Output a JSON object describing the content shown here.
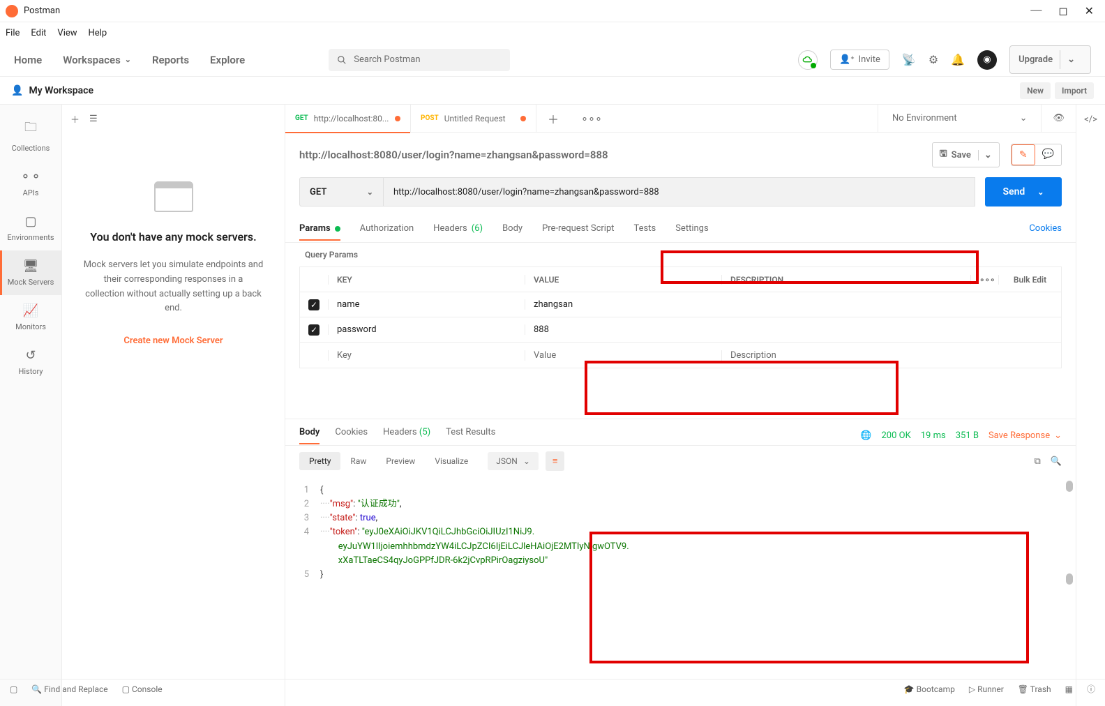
{
  "window": {
    "title": "Postman"
  },
  "menu": {
    "file": "File",
    "edit": "Edit",
    "view": "View",
    "help": "Help"
  },
  "topnav": {
    "home": "Home",
    "workspaces": "Workspaces",
    "reports": "Reports",
    "explore": "Explore",
    "search_placeholder": "Search Postman",
    "invite": "Invite",
    "upgrade": "Upgrade"
  },
  "workspace": {
    "name": "My Workspace",
    "new": "New",
    "import": "Import"
  },
  "sidebar": {
    "items": [
      {
        "label": "Collections"
      },
      {
        "label": "APIs"
      },
      {
        "label": "Environments"
      },
      {
        "label": "Mock Servers"
      },
      {
        "label": "Monitors"
      },
      {
        "label": "History"
      }
    ]
  },
  "mock": {
    "title": "You don't have any mock servers.",
    "desc": "Mock servers let you simulate endpoints and their corresponding responses in a collection without actually setting up a back end.",
    "link": "Create new Mock Server"
  },
  "tabs": [
    {
      "method": "GET",
      "title": "http://localhost:80...",
      "dirty": true
    },
    {
      "method": "POST",
      "title": "Untitled Request",
      "dirty": true
    }
  ],
  "env": {
    "current": "No Environment"
  },
  "request": {
    "display_url": "http://localhost:8080/user/login?name=zhangsan&password=888",
    "save": "Save",
    "method": "GET",
    "url": "http://localhost:8080/user/login?name=zhangsan&password=888",
    "send": "Send"
  },
  "reqtabs": {
    "params": "Params",
    "auth": "Authorization",
    "headers": "Headers",
    "headers_count": "(6)",
    "body": "Body",
    "prereq": "Pre-request Script",
    "tests": "Tests",
    "settings": "Settings",
    "cookies": "Cookies"
  },
  "qparams": {
    "title": "Query Params",
    "columns": {
      "key": "KEY",
      "value": "VALUE",
      "desc": "DESCRIPTION",
      "bulk": "Bulk Edit"
    },
    "rows": [
      {
        "key": "name",
        "value": "zhangsan"
      },
      {
        "key": "password",
        "value": "888"
      }
    ],
    "placeholder": {
      "key": "Key",
      "value": "Value",
      "desc": "Description"
    }
  },
  "response": {
    "tabs": {
      "body": "Body",
      "cookies": "Cookies",
      "headers": "Headers",
      "headers_count": "(5)",
      "tests": "Test Results"
    },
    "status_code": "200 OK",
    "time": "19 ms",
    "size": "351 B",
    "save": "Save Response",
    "fmt": {
      "pretty": "Pretty",
      "raw": "Raw",
      "preview": "Preview",
      "visualize": "Visualize",
      "json": "JSON"
    },
    "lines": {
      "l1": "{",
      "l2_key": "\"msg\"",
      "l2_val": "\"认证成功\"",
      "l3_key": "\"state\"",
      "l3_val": "true",
      "l4_key": "\"token\"",
      "l4_val": "\"eyJ0eXAiOiJKV1QiLCJhbGciOiJIUzI1NiJ9.",
      "l4c1": "eyJuYW1lIjoiemhhbmdzYW4iLCJpZCI6IjEiLCJleHAiOjE2MTIyNjgwOTV9.",
      "l4c2": "xXaTLTaeCS4qyJoGPPfJDR-6k2jCvpRPirOagziysoU\"",
      "l5": "}"
    }
  },
  "footer": {
    "find": "Find and Replace",
    "console": "Console",
    "bootcamp": "Bootcamp",
    "runner": "Runner",
    "trash": "Trash"
  }
}
